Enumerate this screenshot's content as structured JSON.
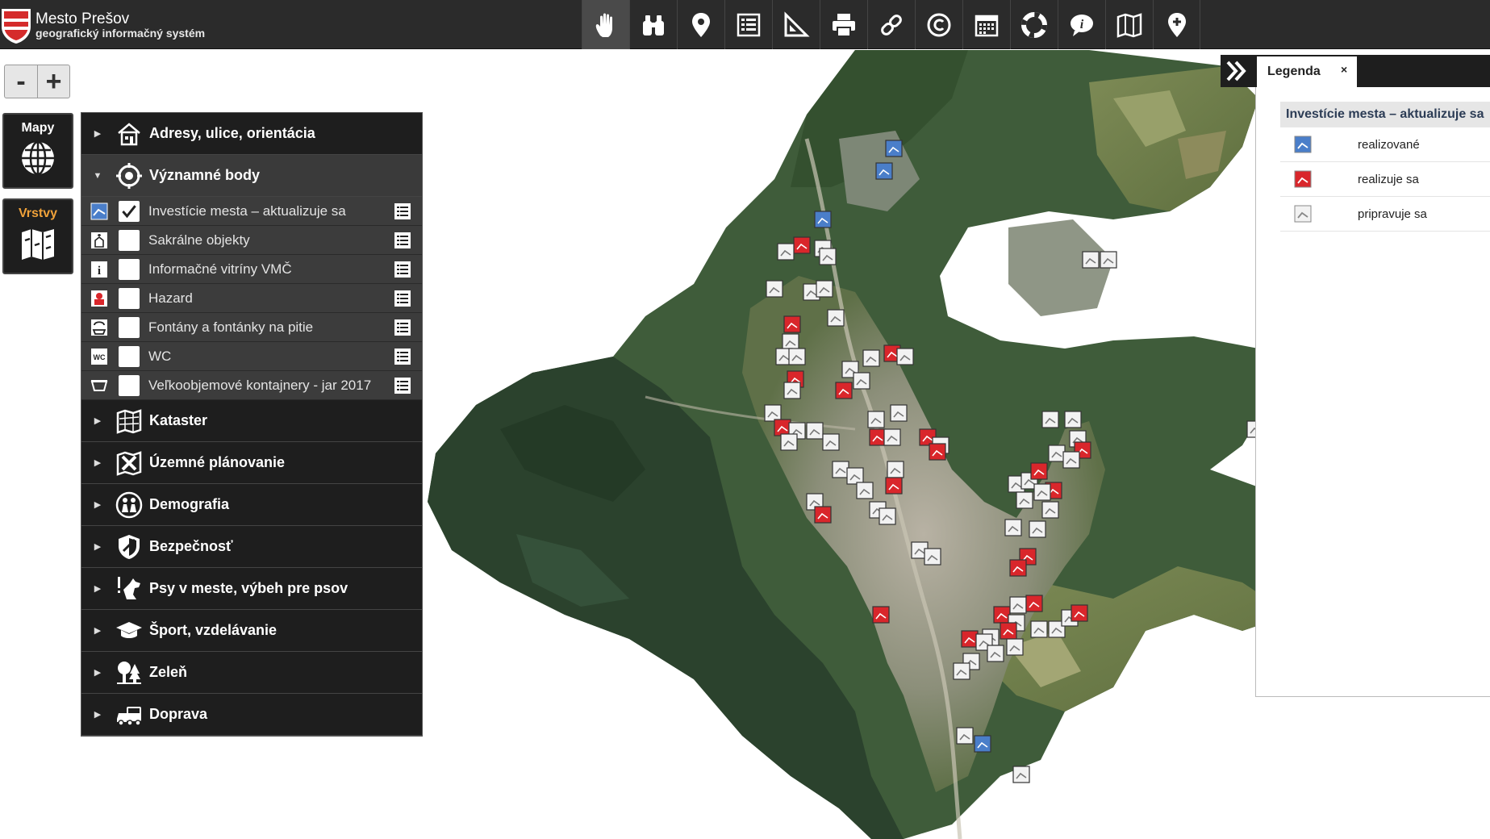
{
  "app": {
    "title": "Mesto Prešov",
    "subtitle": "geografický informačný systém"
  },
  "toolbar": {
    "tools": [
      {
        "name": "pan",
        "icon": "hand-icon",
        "active": true
      },
      {
        "name": "search",
        "icon": "binoculars-icon",
        "active": false
      },
      {
        "name": "locate",
        "icon": "map-pin-icon",
        "active": false
      },
      {
        "name": "list",
        "icon": "list-icon",
        "active": false
      },
      {
        "name": "measure",
        "icon": "ruler-triangle-icon",
        "active": false
      },
      {
        "name": "print",
        "icon": "printer-icon",
        "active": false
      },
      {
        "name": "link",
        "icon": "link-icon",
        "active": false
      },
      {
        "name": "copyright",
        "icon": "copyright-icon",
        "active": false
      },
      {
        "name": "calendar",
        "icon": "calendar-icon",
        "active": false
      },
      {
        "name": "help",
        "icon": "lifebuoy-icon",
        "active": false
      },
      {
        "name": "info",
        "icon": "info-icon",
        "active": false
      },
      {
        "name": "map-compare",
        "icon": "folded-map-icon",
        "active": false
      },
      {
        "name": "add-point",
        "icon": "pin-plus-icon",
        "active": false
      }
    ]
  },
  "zoom": {
    "minus": "-",
    "plus": "+"
  },
  "side": {
    "mapy": "Mapy",
    "vrstvy": "Vrstvy"
  },
  "layers": {
    "groups": [
      {
        "label": "Adresy, ulice, orientácia",
        "icon": "house-icon",
        "open": false
      },
      {
        "label": "Významné body",
        "icon": "target-icon",
        "open": true,
        "items": [
          {
            "label": "Investície mesta – aktualizuje sa",
            "icon": "investment-icon",
            "checked": true
          },
          {
            "label": "Sakrálne objekty",
            "icon": "church-icon",
            "checked": false
          },
          {
            "label": "Informačné vitríny VMČ",
            "icon": "info-board-icon",
            "checked": false
          },
          {
            "label": "Hazard",
            "icon": "hazard-icon",
            "checked": false
          },
          {
            "label": "Fontány a fontánky na pitie",
            "icon": "fountain-icon",
            "checked": false
          },
          {
            "label": "WC",
            "icon": "wc-icon",
            "checked": false
          },
          {
            "label": "Veľkoobjemové kontajnery - jar 2017",
            "icon": "container-icon",
            "checked": false
          }
        ]
      },
      {
        "label": "Kataster",
        "icon": "cadastre-icon",
        "open": false
      },
      {
        "label": "Územné plánovanie",
        "icon": "planning-icon",
        "open": false
      },
      {
        "label": "Demografia",
        "icon": "people-icon",
        "open": false
      },
      {
        "label": "Bezpečnosť",
        "icon": "shield-icon",
        "open": false
      },
      {
        "label": "Psy v meste, výbeh pre psov",
        "icon": "dog-icon",
        "open": false
      },
      {
        "label": "Šport, vzdelávanie",
        "icon": "graduation-cap-icon",
        "open": false
      },
      {
        "label": "Zeleň",
        "icon": "trees-icon",
        "open": false
      },
      {
        "label": "Doprava",
        "icon": "vehicles-icon",
        "open": false
      }
    ]
  },
  "legend": {
    "tab": "Legenda",
    "close": "×",
    "heading": "Investície mesta – aktualizuje sa",
    "items": [
      {
        "label": "realizované",
        "color": "#4a7ec9"
      },
      {
        "label": "realizuje sa",
        "color": "#d9262b"
      },
      {
        "label": "pripravuje sa",
        "color": "#f2f2f2"
      }
    ]
  },
  "colors": {
    "topbar": "#2b2b2b",
    "panel": "#1e1e1e",
    "accent": "#f0a23a",
    "forest": "#2f4a33",
    "meadow": "#6f8a4b"
  }
}
